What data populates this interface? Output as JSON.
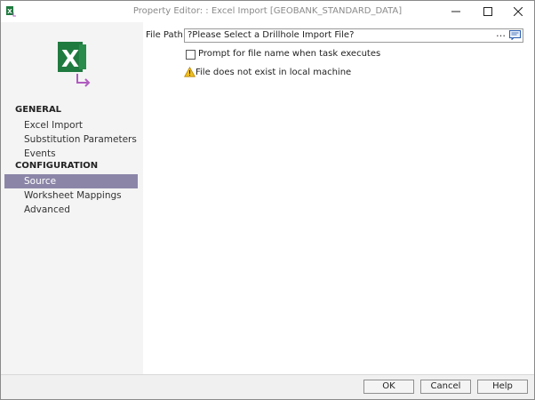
{
  "window": {
    "title": "Property Editor: : Excel Import [GEOBANK_STANDARD_DATA]"
  },
  "icons": {
    "app": "excel-app-icon",
    "logo": "excel-import-logo-icon",
    "browse": "ellipsis-icon",
    "message": "message-icon",
    "warning": "warning-icon"
  },
  "sidebar": {
    "sections": [
      {
        "label": "GENERAL"
      },
      {
        "label": "CONFIGURATION"
      }
    ],
    "items": [
      {
        "label": "Excel Import",
        "selected": false
      },
      {
        "label": "Substitution Parameters",
        "selected": false
      },
      {
        "label": "Events",
        "selected": false
      },
      {
        "label": "Source",
        "selected": true
      },
      {
        "label": "Worksheet Mappings",
        "selected": false
      },
      {
        "label": "Advanced",
        "selected": false
      }
    ]
  },
  "main": {
    "file_path_label": "File Path",
    "file_path_value": "?Please Select a Drillhole Import File?",
    "browse_label": "…",
    "prompt_label": "Prompt for file name when task executes",
    "prompt_checked": false,
    "warning_text": "File does not exist in local machine"
  },
  "footer": {
    "ok_label": "OK",
    "cancel_label": "Cancel",
    "help_label": "Help"
  },
  "colors": {
    "selected_bg": "#8b86a8",
    "excel_green": "#1f7a3f",
    "arrow_purple": "#b05cc0",
    "warning_yellow": "#f0c020"
  }
}
